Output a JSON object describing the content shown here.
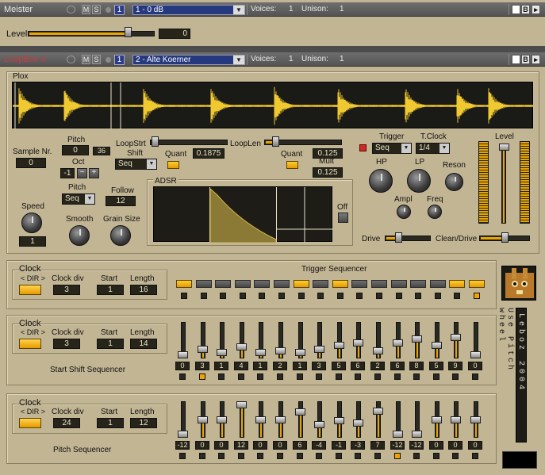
{
  "colors": {
    "accent": "#e8a400",
    "panel": "#c2b594",
    "lcd_bg": "#27251a",
    "header": "#5e5e5e"
  },
  "meister": {
    "name": "Meister",
    "m_label": "M",
    "s_label": "S",
    "channel": "1",
    "preset": "1 - 0 dB",
    "voices_label": "Voices:",
    "voices": "1",
    "unison_label": "Unison:",
    "unison": "1",
    "level_label": "Level",
    "level_value": "0",
    "level_fraction": 0.85
  },
  "loopbox": {
    "name": "LoopBox II",
    "m_label": "M",
    "s_label": "S",
    "channel": "1",
    "preset": "2 - Alte Koerner",
    "voices_label": "Voices:",
    "voices": "1",
    "unison_label": "Unison:",
    "unison": "1"
  },
  "plox": {
    "title": "Plox",
    "sample_nr_label": "Sample Nr.",
    "sample_nr": "0",
    "pitch_label": "Pitch",
    "pitch_value": "0",
    "pitch_secondary": "36",
    "oct_label": "Oct",
    "oct_value": "-1",
    "oct_minus": "−",
    "oct_plus": "+",
    "pitch_mode_label": "Pitch",
    "pitch_mode": "Seq",
    "follow_label": "Follow",
    "follow_value": "12",
    "loopstrt_label": "LoopStrt",
    "shift_label": "Shift",
    "shift_mode": "Seq",
    "quant_label": "Quant",
    "loopstrt_value": "0.1875",
    "looplen_label": "LoopLen",
    "looplen_quant_label": "Quant",
    "looplen_value": "0.125",
    "mult_label": "Mult",
    "mult_value": "0.125",
    "speed_label": "Speed",
    "speed_value": "1",
    "smooth_label": "Smooth",
    "grain_label": "Grain Size",
    "adsr_label": "ADSR",
    "off_label": "Off",
    "trigger_label": "Trigger",
    "trigger_mode": "Seq",
    "tclock_label": "T.Clock",
    "tclock_value": "1/4",
    "hp_label": "HP",
    "lp_label": "LP",
    "reson_label": "Reson",
    "ampl_label": "Ampl",
    "freq_label": "Freq",
    "level_label": "Level",
    "drive_label": "Drive",
    "clean_drive_label": "Clean/Drive"
  },
  "trigger_seq": {
    "clock_label": "Clock",
    "dir_label": "< DIR >",
    "clockdiv_label": "Clock div",
    "clockdiv": "3",
    "start_label": "Start",
    "start": "1",
    "length_label": "Length",
    "length": "16",
    "title": "Trigger Sequencer",
    "steps": [
      1,
      0,
      0,
      0,
      0,
      0,
      1,
      0,
      1,
      0,
      0,
      0,
      0,
      0,
      1,
      1
    ],
    "active_step": 15
  },
  "shift_seq": {
    "clock_label": "Clock",
    "dir_label": "< DIR >",
    "clockdiv_label": "Clock div",
    "clockdiv": "3",
    "start_label": "Start",
    "start": "1",
    "length_label": "Length",
    "length": "14",
    "title": "Start Shift Sequencer",
    "values": [
      "0",
      "3",
      "1",
      "4",
      "1",
      "2",
      "1",
      "3",
      "5",
      "6",
      "2",
      "6",
      "8",
      "5",
      "9",
      "0"
    ],
    "levels": [
      0.0,
      0.2,
      0.07,
      0.27,
      0.07,
      0.13,
      0.07,
      0.2,
      0.33,
      0.4,
      0.13,
      0.4,
      0.53,
      0.33,
      0.6,
      0.0
    ],
    "active_step": 1
  },
  "pitch_seq": {
    "clock_label": "Clock",
    "dir_label": "< DIR >",
    "clockdiv_label": "Clock div",
    "clockdiv": "24",
    "start_label": "Start",
    "start": "1",
    "length_label": "Length",
    "length": "12",
    "title": "Pitch Sequencer",
    "values": [
      "-12",
      "0",
      "0",
      "12",
      "0",
      "0",
      "6",
      "-4",
      "-1",
      "-3",
      "7",
      "-12",
      "-12",
      "0",
      "0",
      "0"
    ],
    "levels": [
      0.0,
      0.5,
      0.5,
      1.0,
      0.5,
      0.5,
      0.75,
      0.33,
      0.46,
      0.38,
      0.79,
      0.0,
      0.0,
      0.5,
      0.5,
      0.5
    ],
    "active_step": 11
  },
  "side": {
    "use_pitch_wheel": "Use Pitch wheel",
    "credit": "Leboz 2004",
    "logo_icon": "bunny-logo"
  }
}
